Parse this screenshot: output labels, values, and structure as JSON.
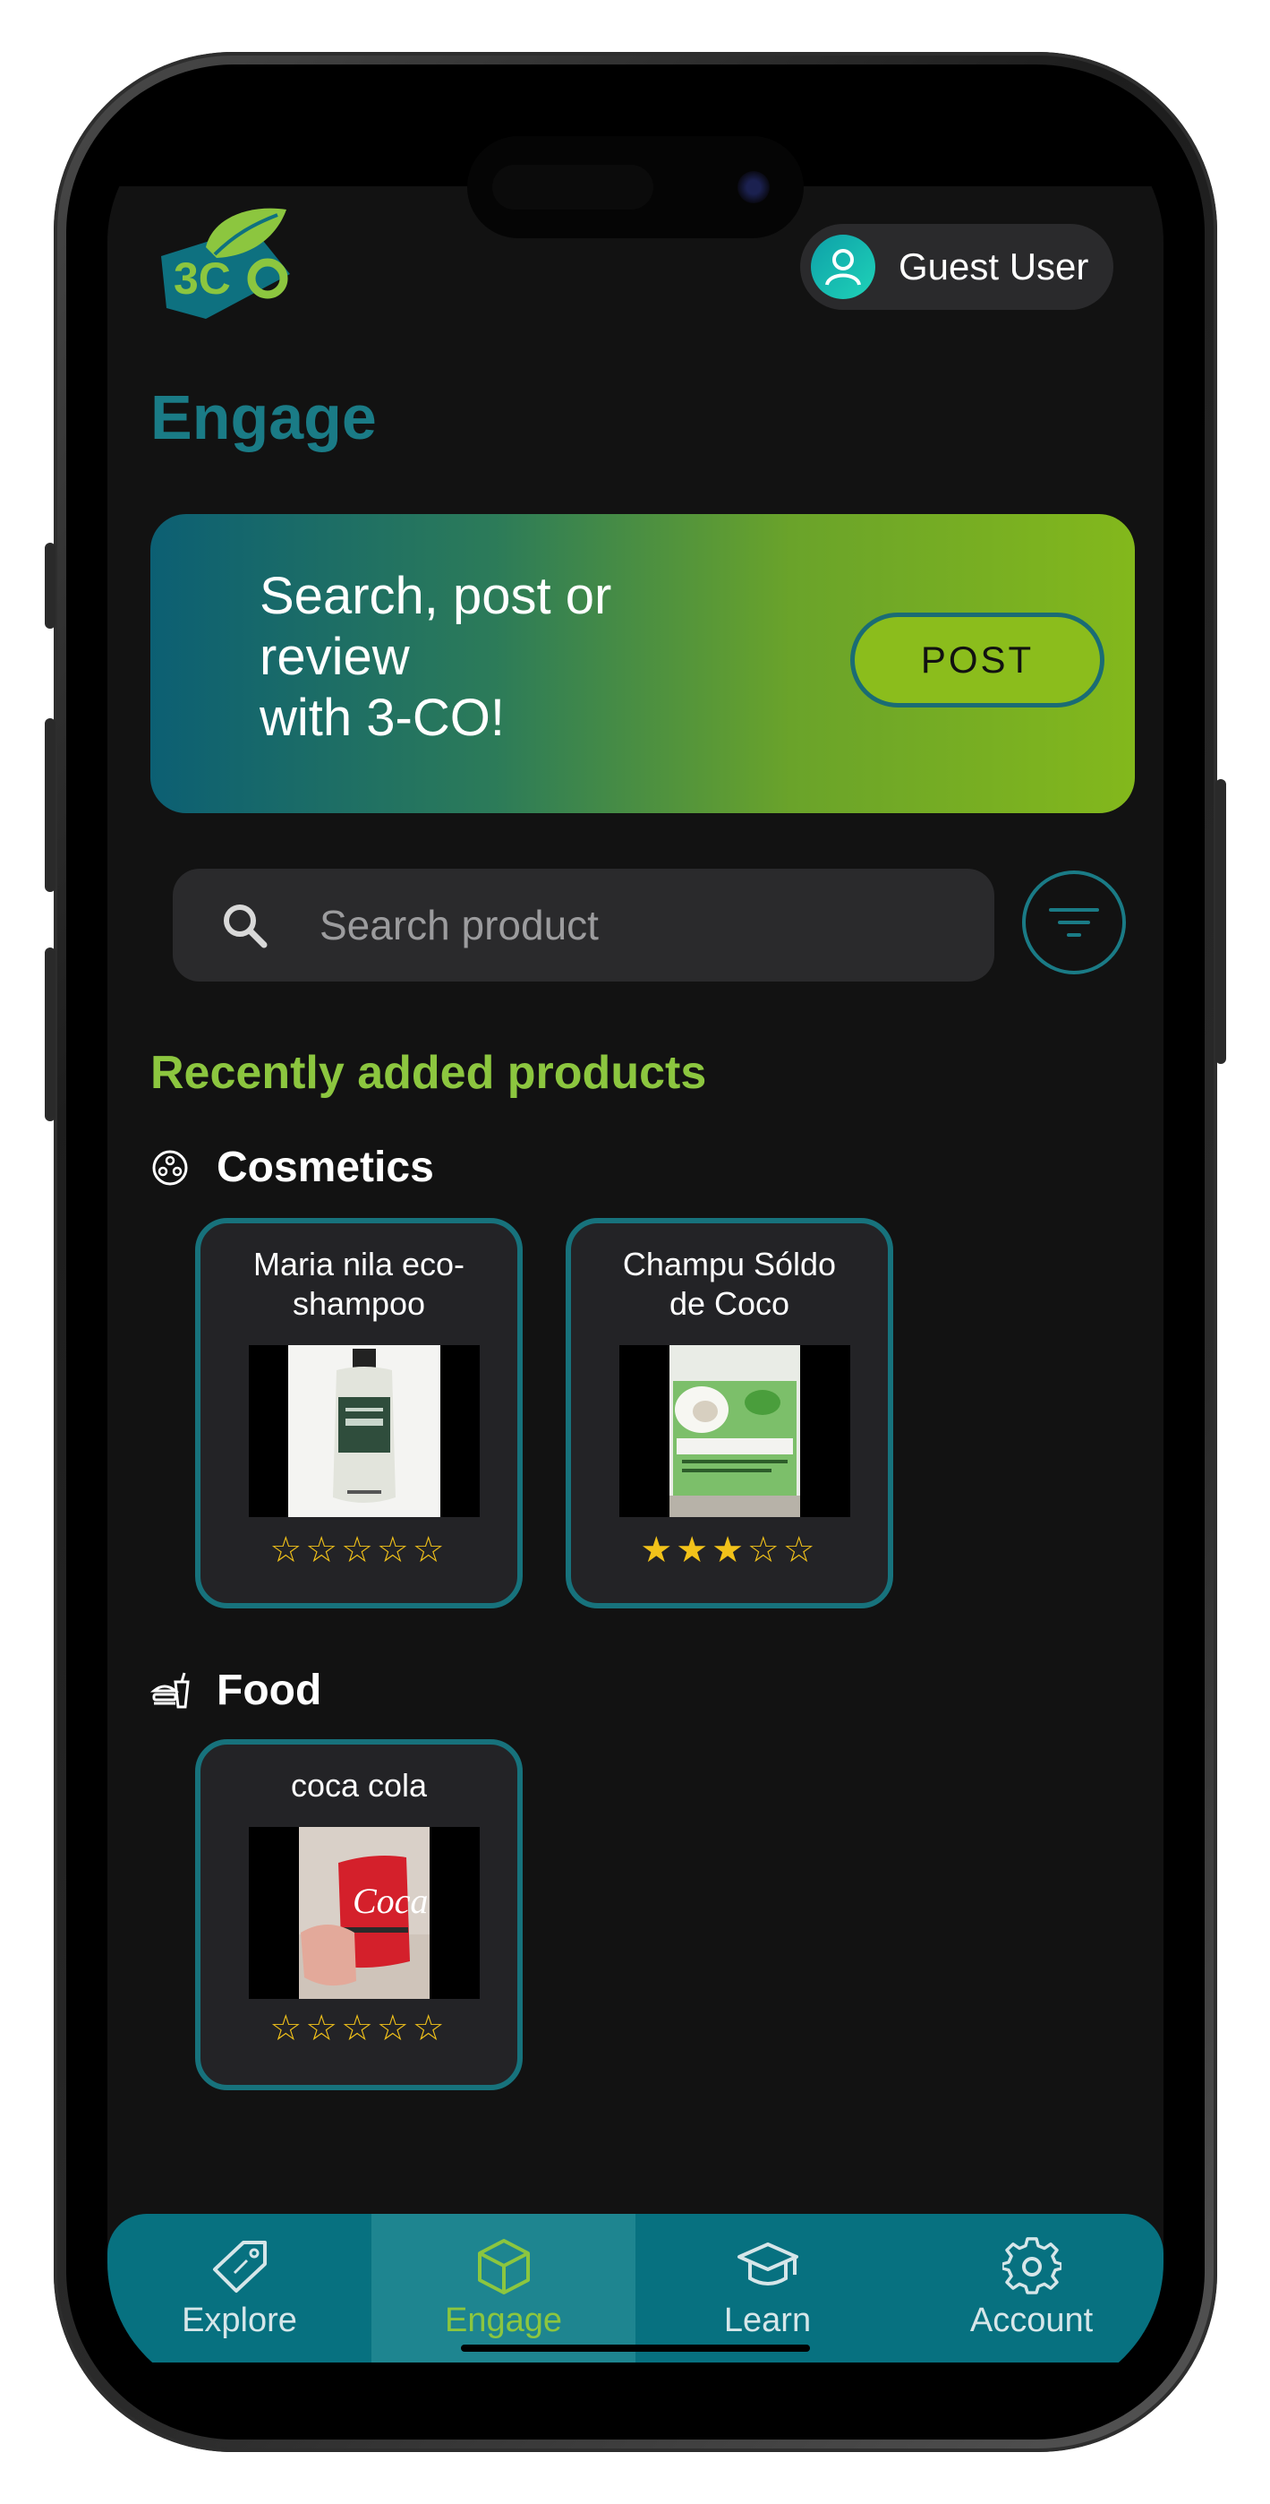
{
  "header": {
    "logo_text": "3CO",
    "user_name": "Guest User"
  },
  "page": {
    "title": "Engage"
  },
  "banner": {
    "text": "Search, post or\nreview\nwith 3-CO!",
    "post_label": "POST"
  },
  "search": {
    "placeholder": "Search product"
  },
  "recent": {
    "title": "Recently added products",
    "categories": [
      {
        "label": "Cosmetics",
        "icon": "cosmetics-icon",
        "products": [
          {
            "name": "Maria nila eco-\nshampoo",
            "stars": "☆☆☆☆☆",
            "rating": 0
          },
          {
            "name": "Champu Sóldo\nde Coco",
            "stars": "★★★☆☆",
            "rating": 3
          }
        ]
      },
      {
        "label": "Food",
        "icon": "food-icon",
        "products": [
          {
            "name": "coca cola",
            "stars": "☆☆☆☆☆",
            "rating": 0
          }
        ]
      }
    ]
  },
  "tabs": [
    {
      "label": "Explore",
      "icon": "tag-icon",
      "active": false
    },
    {
      "label": "Engage",
      "icon": "cube-icon",
      "active": true
    },
    {
      "label": "Learn",
      "icon": "graduation-cap-icon",
      "active": false
    },
    {
      "label": "Account",
      "icon": "gear-icon",
      "active": false
    }
  ],
  "colors": {
    "accent_teal": "#1a7b86",
    "accent_green": "#8cc63f",
    "star": "#f2c21a",
    "tabbar": "#077180"
  }
}
